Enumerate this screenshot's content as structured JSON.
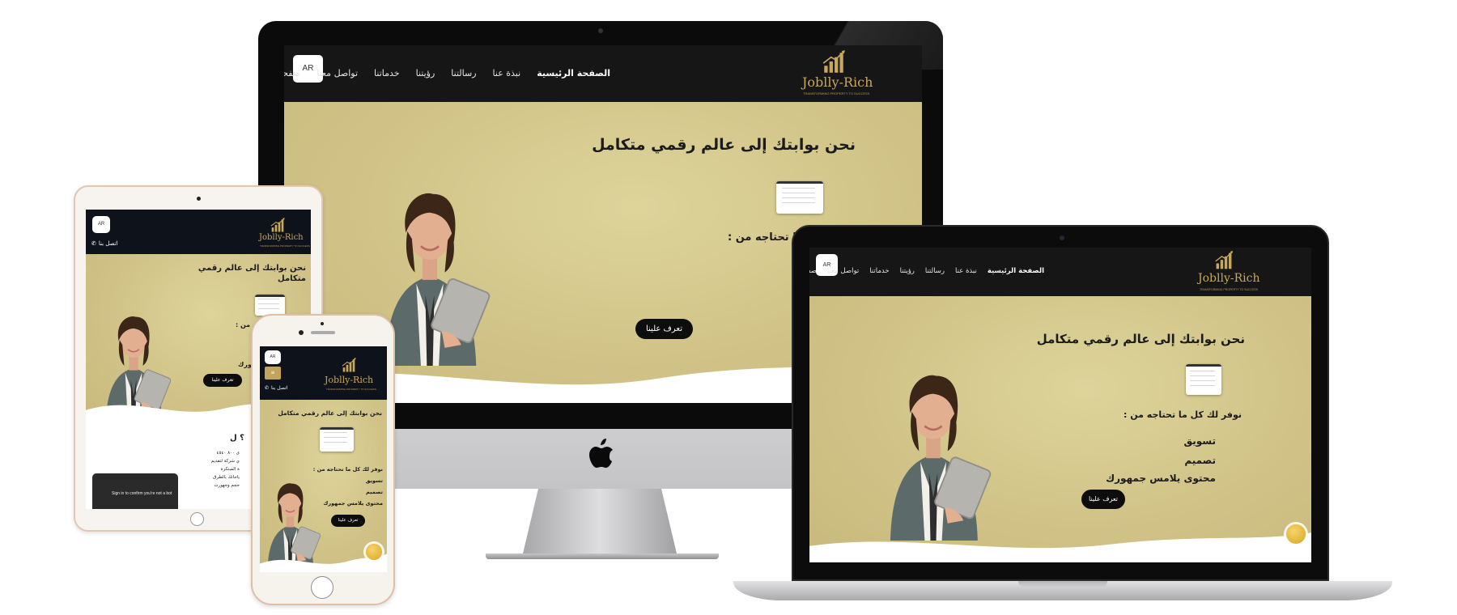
{
  "brand": {
    "name": "Joblly-Rich",
    "tagline": "TRANSFORMING PROPERTY TO SUCCESS",
    "accent": "#c8a85a",
    "hero_color": "#d4c68a",
    "nav_color": "#161616"
  },
  "nav": {
    "items": [
      "الصفحة الرئيسية",
      "نبذة عنا",
      "رسالتنا",
      "رؤيتنا",
      "خدماتنا",
      "تواصل معنا",
      "صفحات"
    ],
    "lang": "AR",
    "contact": "اتصل بنا"
  },
  "hero": {
    "headline": "نحن بوابتك إلى عالم رقمي متكامل",
    "subtitle": "نوفر لك كل ما تحتاجه من :",
    "subtitle_partial": "ما تحتاجه من :",
    "services": [
      "تسويق",
      "تصميم",
      "محتوى يلامس جمهورك"
    ],
    "cta": "تعرف علينا"
  },
  "tablet": {
    "headline_l1": "نحن بوابتك إلى عالم رقمي",
    "headline_l2": "متكامل",
    "subtitle_partial": "من :",
    "service_partial": "ورك",
    "next_section_title": "؟ ل",
    "body_lines": [
      "ى ٨٠٠ ٤٥٤٠",
      "ي شركة لتقديم",
      "ة المبتكرة",
      "ياجاتك بالطرق",
      "حجم وجهورت"
    ],
    "captcha_text": "Sign in to confirm you're not a bot"
  },
  "icons": {
    "apple": "apple-logo-icon",
    "phone": "phone-icon",
    "chevron": "chevron-down-icon",
    "logo": "bar-chart-logo-icon",
    "fab": "call-fab-icon"
  }
}
